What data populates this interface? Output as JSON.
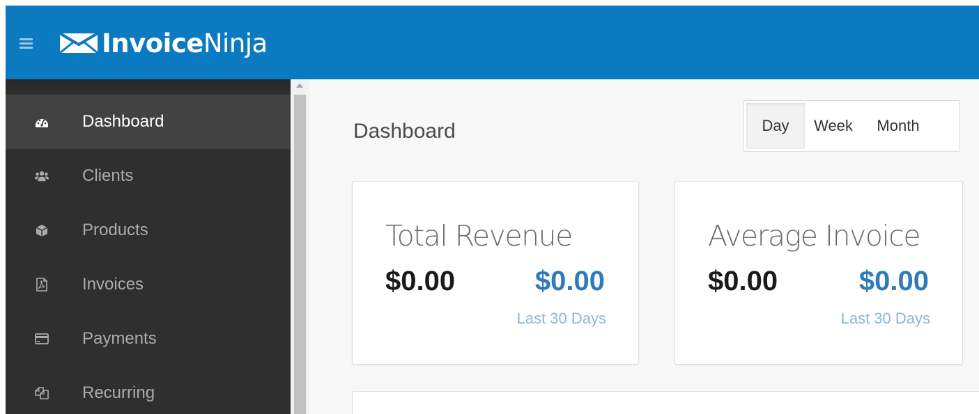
{
  "brand": {
    "name_bold": "Invoice",
    "name_light": "Ninja"
  },
  "sidebar": {
    "items": [
      {
        "label": "Dashboard",
        "icon": "dashboard-icon",
        "active": true
      },
      {
        "label": "Clients",
        "icon": "users-icon",
        "active": false
      },
      {
        "label": "Products",
        "icon": "cube-icon",
        "active": false
      },
      {
        "label": "Invoices",
        "icon": "pdf-file-icon",
        "active": false
      },
      {
        "label": "Payments",
        "icon": "credit-card-icon",
        "active": false
      },
      {
        "label": "Recurring",
        "icon": "files-icon",
        "active": false
      }
    ]
  },
  "header": {
    "title": "Dashboard"
  },
  "range": {
    "options": [
      "Day",
      "Week",
      "Month"
    ],
    "selected": "Day"
  },
  "cards": [
    {
      "title": "Total Revenue",
      "total": "$0.00",
      "period_value": "$0.00",
      "period_label": "Last 30 Days"
    },
    {
      "title": "Average Invoice",
      "total": "$0.00",
      "period_value": "$0.00",
      "period_label": "Last 30 Days"
    }
  ],
  "colors": {
    "topbar": "#0b7ac0",
    "sidebar": "#2f2f2f",
    "sidebar_active": "#424242",
    "accent_value": "#2f7ab8",
    "accent_sub": "#8cb6d8"
  }
}
